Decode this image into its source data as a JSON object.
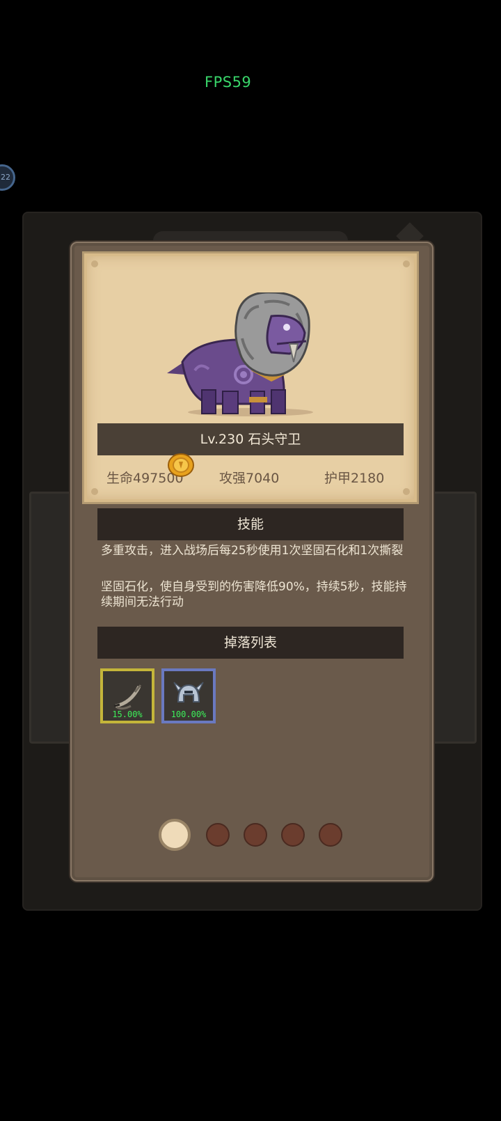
{
  "hud": {
    "fps": "FPS59",
    "side_badge": "22"
  },
  "monster": {
    "title": "Lv.230 石头守卫",
    "stats": [
      {
        "label": "生命497500"
      },
      {
        "label": "攻强7040"
      },
      {
        "label": "护甲2180"
      }
    ]
  },
  "skills": {
    "header": "技能",
    "lines": [
      "多重攻击，进入战场后每25秒使用1次坚固石化和1次撕裂",
      "坚固石化，使自身受到的伤害降低90%，持续5秒，技能持续期间无法行动"
    ]
  },
  "drops": {
    "header": "掉落列表",
    "items": [
      {
        "name": "bow-item-icon",
        "chance": "15.00%",
        "frame_color": "#c4b53a"
      },
      {
        "name": "helmet-item-icon",
        "chance": "100.00%",
        "frame_color": "#6a79c0"
      }
    ]
  },
  "pager": {
    "total": 5,
    "current": 1
  },
  "colors": {
    "accent_green": "#3df05a",
    "fps_green": "#39d66a"
  }
}
